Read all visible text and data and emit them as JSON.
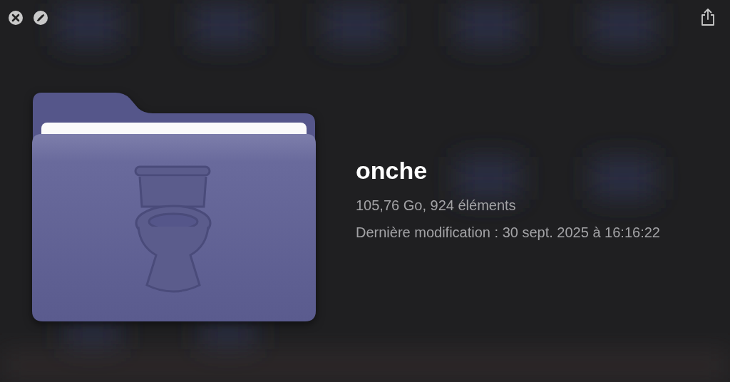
{
  "file": {
    "name": "onche",
    "summary": "105,76 Go, 924 éléments",
    "modified": "Dernière modification : 30 sept. 2025 à 16:16:22"
  }
}
